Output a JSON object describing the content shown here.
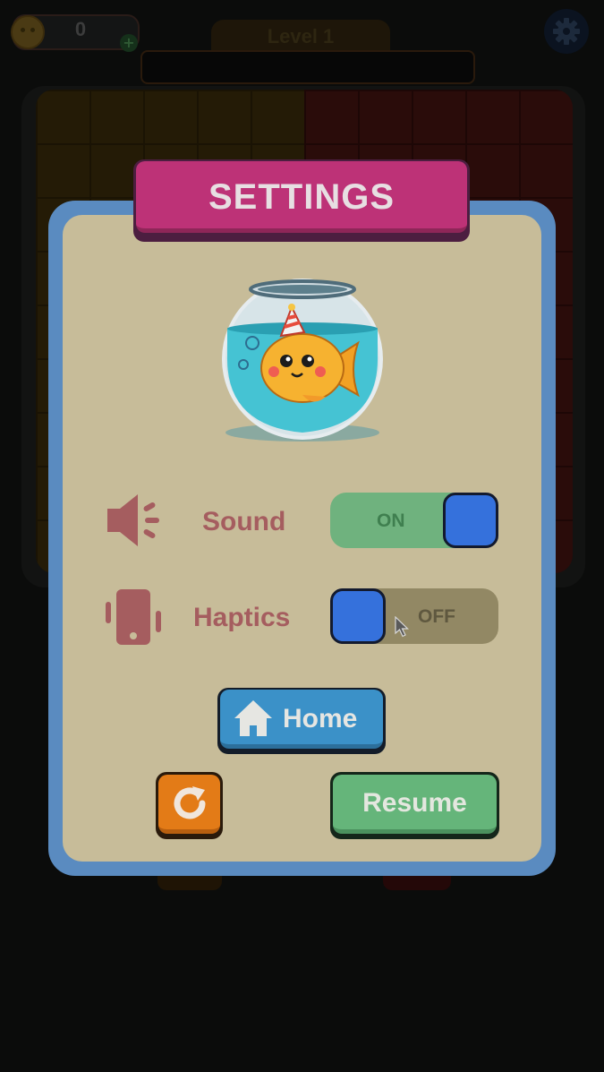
{
  "hud": {
    "coin_count": "0",
    "coin_plus": "+",
    "level_label": "Level 1"
  },
  "settings": {
    "title": "SETTINGS",
    "sound": {
      "label": "Sound",
      "state_text": "ON",
      "enabled": true
    },
    "haptics": {
      "label": "Haptics",
      "state_text": "OFF",
      "enabled": false
    },
    "home_button": "Home",
    "resume_button": "Resume"
  },
  "colors": {
    "modal_border": "#5a8bc0",
    "modal_panel": "#c7bc99",
    "title_ribbon": "#bd3277",
    "toggle_on": "#6fb27e",
    "toggle_off": "#928864",
    "toggle_knob": "#3571dc",
    "home_button": "#3b91c8",
    "restart_button": "#e37b17",
    "resume_button": "#65b57a",
    "label_text": "#a55d5f"
  },
  "icons": {
    "gear": "gear-icon",
    "coin": "smiley-coin-icon",
    "sound": "speaker-icon",
    "haptics": "phone-vibrate-icon",
    "home": "house-icon",
    "restart": "restart-icon",
    "mascot": "fishbowl-goldfish-illustration"
  }
}
